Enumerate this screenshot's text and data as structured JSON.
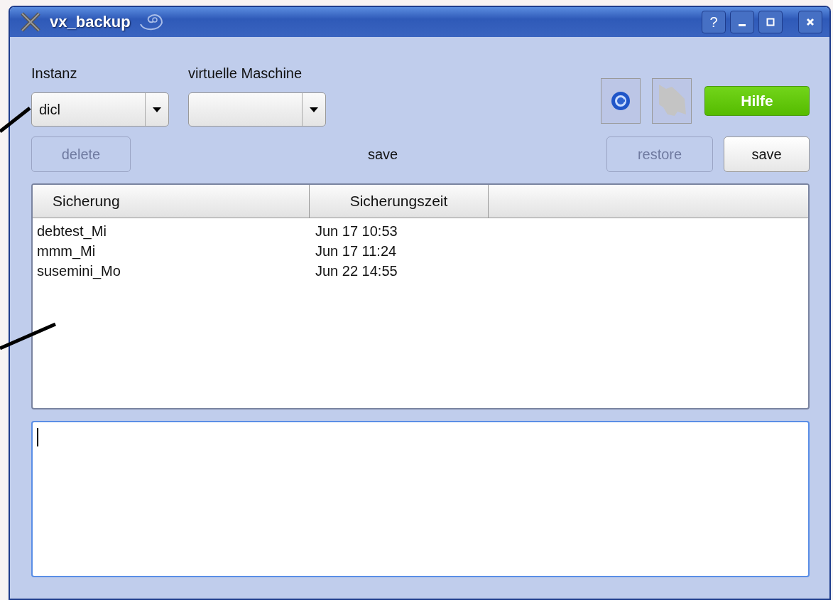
{
  "window": {
    "title": "vx_backup",
    "controls": [
      {
        "kind": "help",
        "label": "?"
      },
      {
        "kind": "minimize"
      },
      {
        "kind": "maximize"
      },
      {
        "kind": "close"
      }
    ]
  },
  "selectors": [
    {
      "label": "Instanz",
      "value": "dicl"
    },
    {
      "label": "virtuelle Maschine"
    }
  ],
  "toolbar": {
    "tool_buttons": [
      {
        "kind": "globe"
      },
      {
        "kind": "map"
      }
    ],
    "help_button": "Hilfe"
  },
  "actions": {
    "delete": {
      "label": "delete",
      "disabled": true
    },
    "mode_label": "save",
    "restore": {
      "label": "restore",
      "disabled": true
    },
    "save": {
      "label": "save",
      "disabled": false
    }
  },
  "table": {
    "columns": [
      "Sicherung",
      "Sicherungszeit"
    ],
    "rows": [
      {
        "cells": [
          "debtest_Mi",
          "Jun 17 10:53"
        ]
      },
      {
        "cells": [
          "mmm_Mi",
          "Jun 17 11:24"
        ]
      },
      {
        "cells": [
          "susemini_Mo",
          "Jun 22 14:55"
        ]
      }
    ]
  },
  "log": {
    "focused": true
  }
}
